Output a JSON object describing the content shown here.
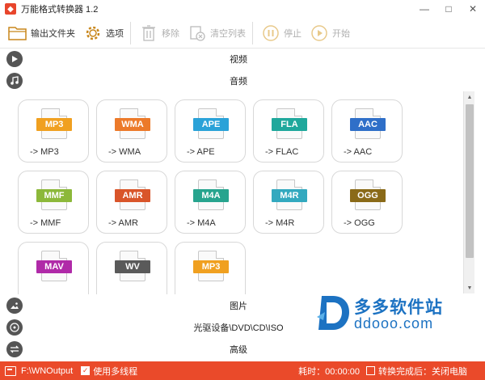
{
  "window": {
    "title": "万能格式转换器 1.2",
    "minimize": "—",
    "maximize": "□",
    "close": "✕"
  },
  "toolbar": {
    "output_folder": "输出文件夹",
    "options": "选项",
    "remove": "移除",
    "clear_list": "清空列表",
    "stop": "停止",
    "start": "开始"
  },
  "sections": {
    "video": "视频",
    "audio": "音频",
    "image": "图片",
    "optical": "光驱设备\\DVD\\CD\\ISO",
    "advanced": "高级"
  },
  "tiles": [
    {
      "format": "MP3",
      "label": "-> MP3",
      "color": "#f0a020"
    },
    {
      "format": "WMA",
      "label": "-> WMA",
      "color": "#ec7a2a"
    },
    {
      "format": "APE",
      "label": "-> APE",
      "color": "#2aa2d8"
    },
    {
      "format": "FLA",
      "label": "-> FLAC",
      "color": "#1fa89c"
    },
    {
      "format": "AAC",
      "label": "-> AAC",
      "color": "#2f6fc8"
    },
    {
      "format": "MMF",
      "label": "-> MMF",
      "color": "#8cb83a"
    },
    {
      "format": "AMR",
      "label": "-> AMR",
      "color": "#d9552a"
    },
    {
      "format": "M4A",
      "label": "-> M4A",
      "color": "#27a48e"
    },
    {
      "format": "M4R",
      "label": "-> M4R",
      "color": "#33a9bf"
    },
    {
      "format": "OGG",
      "label": "-> OGG",
      "color": "#8a6a18"
    },
    {
      "format": "MAV",
      "label": "",
      "color": "#b02aa8"
    },
    {
      "format": "WV",
      "label": "",
      "color": "#5a5a5a"
    },
    {
      "format": "MP3",
      "label": "",
      "color": "#f0a020"
    }
  ],
  "watermark": {
    "text": "多多软件站",
    "url": "ddooo.com"
  },
  "status": {
    "output_path": "F:\\WNOutput",
    "multithread_checked": true,
    "multithread_label": "使用多线程",
    "elapsed": "耗时：00:00:00",
    "after_done_checked": false,
    "after_done_label": "转换完成后：关闭电脑"
  },
  "colors": {
    "accent": "#ea4a2a",
    "watermark": "#1c72c2"
  }
}
